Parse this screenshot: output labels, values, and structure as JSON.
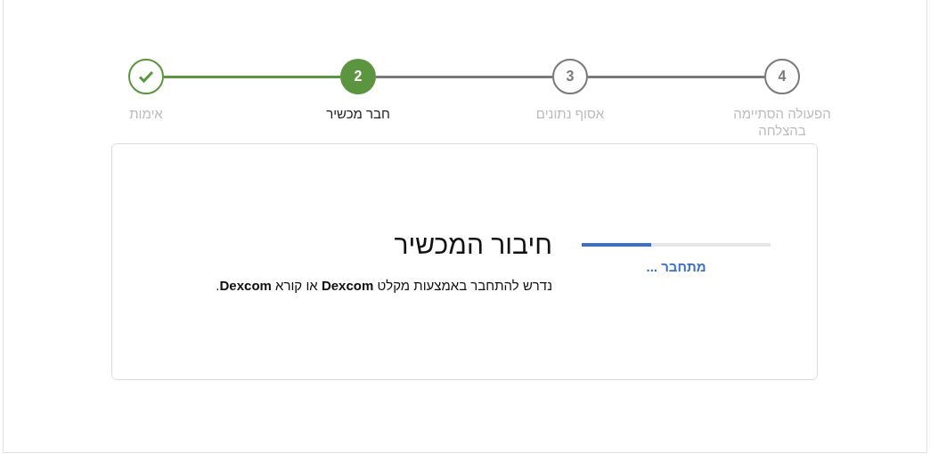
{
  "steps": [
    {
      "number": "4",
      "label": "הפעולה הסתיימה בהצלחה",
      "completed": false,
      "selected": false
    },
    {
      "number": "3",
      "label": "אסוף נתונים",
      "completed": false,
      "selected": false
    },
    {
      "number": "2",
      "label": "חבר מכשיר",
      "completed": false,
      "selected": true
    },
    {
      "label": "אימות",
      "completed": true,
      "selected": false
    }
  ],
  "card": {
    "title": "חיבור המכשיר",
    "description": "נדרש להתחבר באמצעות מקלט **Dexcom** או קורא **Dexcom**.",
    "progress": {
      "level": 0.37,
      "status": "מתחבר ..."
    }
  }
}
